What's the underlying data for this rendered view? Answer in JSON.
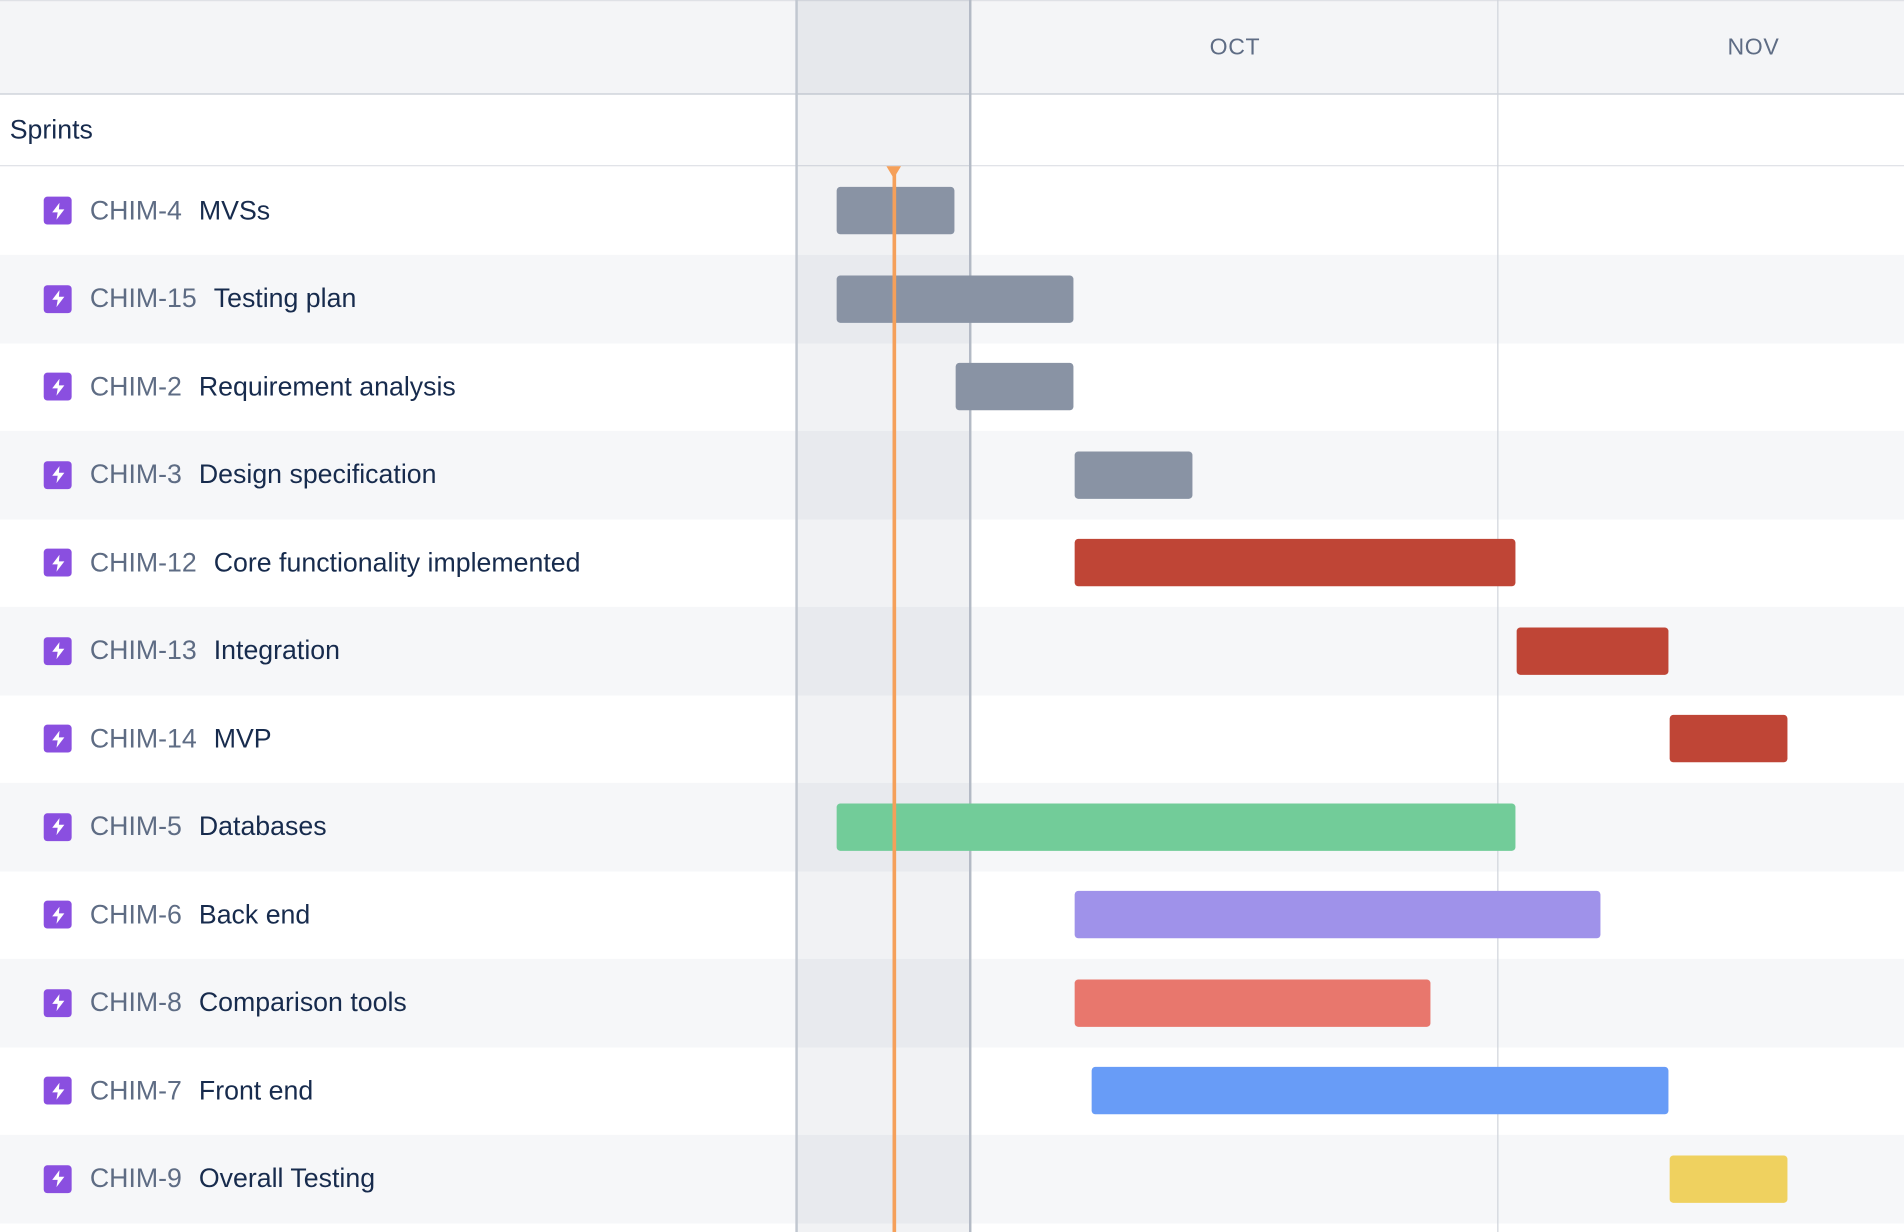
{
  "header": {
    "months": [
      {
        "label": "OCT",
        "name": "month-oct"
      },
      {
        "label": "NOV",
        "name": "month-nov"
      }
    ]
  },
  "section": {
    "title": "Sprints"
  },
  "colors": {
    "epic_icon": "#8a4fe0",
    "today": "#f5a05a",
    "grey": "#8993a4",
    "red": "#bf4536",
    "green": "#72cc99",
    "purple": "#9f92ea",
    "salmon": "#e8776d",
    "blue": "#689cf7",
    "yellow": "#efd15f"
  },
  "items": [
    {
      "key": "CHIM-4",
      "summary": "MVSs",
      "icon": "epic-lightning-icon",
      "color": "grey"
    },
    {
      "key": "CHIM-15",
      "summary": "Testing plan",
      "icon": "epic-lightning-icon",
      "color": "grey"
    },
    {
      "key": "CHIM-2",
      "summary": "Requirement analysis",
      "icon": "epic-lightning-icon",
      "color": "grey"
    },
    {
      "key": "CHIM-3",
      "summary": "Design specification",
      "icon": "epic-lightning-icon",
      "color": "grey"
    },
    {
      "key": "CHIM-12",
      "summary": "Core functionality implemented",
      "icon": "epic-lightning-icon",
      "color": "red"
    },
    {
      "key": "CHIM-13",
      "summary": "Integration",
      "icon": "epic-lightning-icon",
      "color": "red"
    },
    {
      "key": "CHIM-14",
      "summary": "MVP",
      "icon": "epic-lightning-icon",
      "color": "red"
    },
    {
      "key": "CHIM-5",
      "summary": "Databases",
      "icon": "epic-lightning-icon",
      "color": "green"
    },
    {
      "key": "CHIM-6",
      "summary": "Back end",
      "icon": "epic-lightning-icon",
      "color": "purple"
    },
    {
      "key": "CHIM-8",
      "summary": "Comparison tools",
      "icon": "epic-lightning-icon",
      "color": "salmon"
    },
    {
      "key": "CHIM-7",
      "summary": "Front end",
      "icon": "epic-lightning-icon",
      "color": "blue"
    },
    {
      "key": "CHIM-9",
      "summary": "Overall Testing",
      "icon": "epic-lightning-icon",
      "color": "yellow"
    }
  ]
}
